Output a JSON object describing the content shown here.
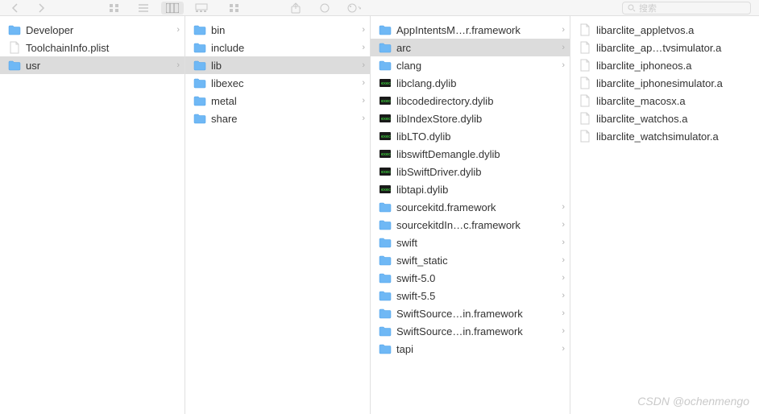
{
  "toolbar": {
    "search_placeholder": "搜索"
  },
  "icons": {
    "folder": "folder",
    "plist": "plist",
    "exec": "exec",
    "archive": "archive"
  },
  "columns": [
    {
      "items": [
        {
          "icon": "folder",
          "label": "Developer",
          "hasChildren": true,
          "selected": false
        },
        {
          "icon": "plist",
          "label": "ToolchainInfo.plist",
          "hasChildren": false,
          "selected": false
        },
        {
          "icon": "folder",
          "label": "usr",
          "hasChildren": true,
          "selected": true
        }
      ]
    },
    {
      "items": [
        {
          "icon": "folder",
          "label": "bin",
          "hasChildren": true,
          "selected": false
        },
        {
          "icon": "folder",
          "label": "include",
          "hasChildren": true,
          "selected": false
        },
        {
          "icon": "folder",
          "label": "lib",
          "hasChildren": true,
          "selected": true
        },
        {
          "icon": "folder",
          "label": "libexec",
          "hasChildren": true,
          "selected": false
        },
        {
          "icon": "folder",
          "label": "metal",
          "hasChildren": true,
          "selected": false
        },
        {
          "icon": "folder",
          "label": "share",
          "hasChildren": true,
          "selected": false
        }
      ]
    },
    {
      "items": [
        {
          "icon": "folder",
          "label": "AppIntentsM…r.framework",
          "hasChildren": true,
          "selected": false
        },
        {
          "icon": "folder",
          "label": "arc",
          "hasChildren": true,
          "selected": true
        },
        {
          "icon": "folder",
          "label": "clang",
          "hasChildren": true,
          "selected": false
        },
        {
          "icon": "exec",
          "label": "libclang.dylib",
          "hasChildren": false,
          "selected": false
        },
        {
          "icon": "exec",
          "label": "libcodedirectory.dylib",
          "hasChildren": false,
          "selected": false
        },
        {
          "icon": "exec",
          "label": "libIndexStore.dylib",
          "hasChildren": false,
          "selected": false
        },
        {
          "icon": "exec",
          "label": "libLTO.dylib",
          "hasChildren": false,
          "selected": false
        },
        {
          "icon": "exec",
          "label": "libswiftDemangle.dylib",
          "hasChildren": false,
          "selected": false
        },
        {
          "icon": "exec",
          "label": "libSwiftDriver.dylib",
          "hasChildren": false,
          "selected": false
        },
        {
          "icon": "exec",
          "label": "libtapi.dylib",
          "hasChildren": false,
          "selected": false
        },
        {
          "icon": "folder",
          "label": "sourcekitd.framework",
          "hasChildren": true,
          "selected": false
        },
        {
          "icon": "folder",
          "label": "sourcekitdIn…c.framework",
          "hasChildren": true,
          "selected": false
        },
        {
          "icon": "folder",
          "label": "swift",
          "hasChildren": true,
          "selected": false
        },
        {
          "icon": "folder",
          "label": "swift_static",
          "hasChildren": true,
          "selected": false
        },
        {
          "icon": "folder",
          "label": "swift-5.0",
          "hasChildren": true,
          "selected": false
        },
        {
          "icon": "folder",
          "label": "swift-5.5",
          "hasChildren": true,
          "selected": false
        },
        {
          "icon": "folder",
          "label": "SwiftSource…in.framework",
          "hasChildren": true,
          "selected": false
        },
        {
          "icon": "folder",
          "label": "SwiftSource…in.framework",
          "hasChildren": true,
          "selected": false
        },
        {
          "icon": "folder",
          "label": "tapi",
          "hasChildren": true,
          "selected": false
        }
      ]
    },
    {
      "items": [
        {
          "icon": "archive",
          "label": "libarclite_appletvos.a",
          "hasChildren": false,
          "selected": false
        },
        {
          "icon": "archive",
          "label": "libarclite_ap…tvsimulator.a",
          "hasChildren": false,
          "selected": false
        },
        {
          "icon": "archive",
          "label": "libarclite_iphoneos.a",
          "hasChildren": false,
          "selected": false
        },
        {
          "icon": "archive",
          "label": "libarclite_iphonesimulator.a",
          "hasChildren": false,
          "selected": false
        },
        {
          "icon": "archive",
          "label": "libarclite_macosx.a",
          "hasChildren": false,
          "selected": false
        },
        {
          "icon": "archive",
          "label": "libarclite_watchos.a",
          "hasChildren": false,
          "selected": false
        },
        {
          "icon": "archive",
          "label": "libarclite_watchsimulator.a",
          "hasChildren": false,
          "selected": false
        }
      ]
    }
  ],
  "watermark": "CSDN @ochenmengo"
}
